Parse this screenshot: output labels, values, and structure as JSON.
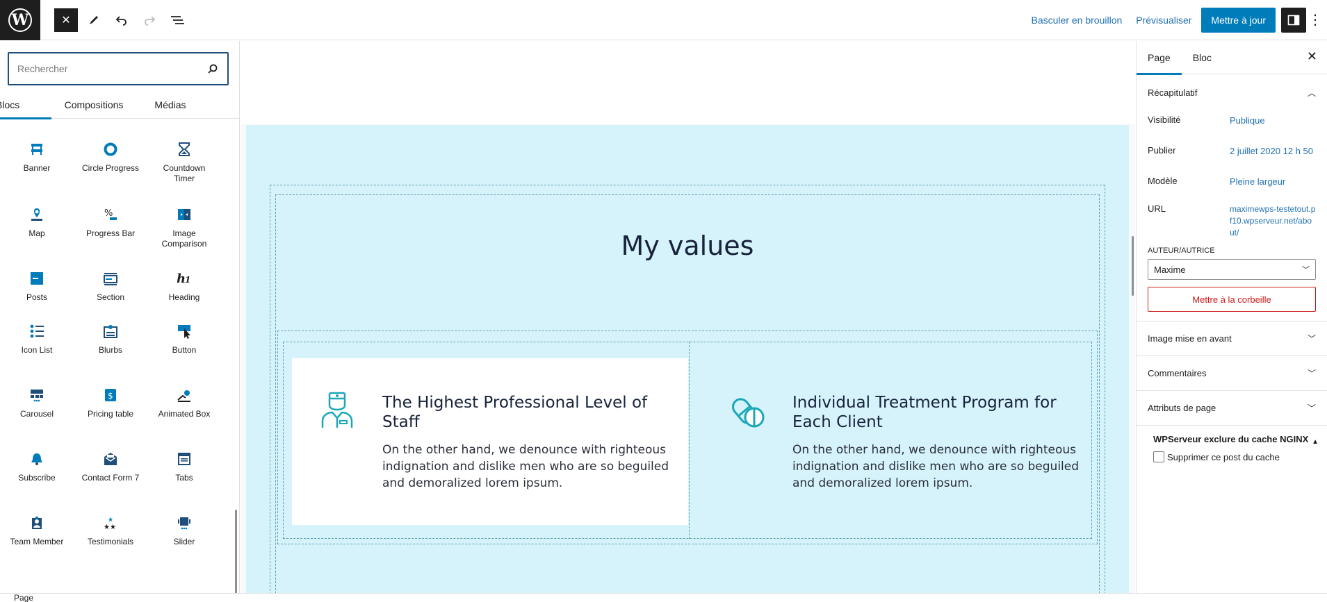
{
  "topbar": {
    "logo_letter": "W",
    "switch_to_draft": "Basculer en brouillon",
    "preview": "Prévisualiser",
    "update": "Mettre à jour"
  },
  "inserter": {
    "search_placeholder": "Rechercher",
    "tabs": [
      "Blocs",
      "Compositions",
      "Médias"
    ],
    "blocks": [
      {
        "label": "Banner",
        "icon": "banner-icon"
      },
      {
        "label": "Circle Progress",
        "icon": "circle-progress-icon"
      },
      {
        "label": "Countdown Timer",
        "icon": "hourglass-icon"
      },
      {
        "label": "Map",
        "icon": "map-pin-icon"
      },
      {
        "label": "Progress Bar",
        "icon": "percent-icon"
      },
      {
        "label": "Image Comparison",
        "icon": "image-comparison-icon"
      },
      {
        "label": "Posts",
        "icon": "posts-icon"
      },
      {
        "label": "Section",
        "icon": "section-icon"
      },
      {
        "label": "Heading",
        "icon": "heading-icon"
      },
      {
        "label": "Icon List",
        "icon": "list-icon"
      },
      {
        "label": "Blurbs",
        "icon": "blurbs-icon"
      },
      {
        "label": "Button",
        "icon": "cursor-icon"
      },
      {
        "label": "Carousel",
        "icon": "carousel-icon"
      },
      {
        "label": "Pricing table",
        "icon": "pricing-icon"
      },
      {
        "label": "Animated Box",
        "icon": "animated-box-icon"
      },
      {
        "label": "Subscribe",
        "icon": "bell-icon"
      },
      {
        "label": "Contact Form 7",
        "icon": "envelope-icon"
      },
      {
        "label": "Tabs",
        "icon": "tabs-icon"
      },
      {
        "label": "Team Member",
        "icon": "team-member-icon"
      },
      {
        "label": "Testimonials",
        "icon": "stars-icon"
      },
      {
        "label": "Slider",
        "icon": "slider-icon"
      }
    ]
  },
  "canvas": {
    "section_title": "My values",
    "cards": [
      {
        "title": "The Highest Professional  Level of Staff",
        "text": "On the other hand, we denounce with righteous indignation and dislike men who are so beguiled and demoralized lorem ipsum.",
        "icon": "doctor-icon"
      },
      {
        "title": "Individual Treatment Program  for Each Client",
        "text": "On the other hand, we denounce with righteous indignation and dislike men who are so beguiled and demoralized lorem ipsum.",
        "icon": "pills-icon"
      }
    ]
  },
  "status_bar": {
    "breadcrumb": "Page"
  },
  "sidebar": {
    "tabs": [
      "Page",
      "Bloc"
    ],
    "summary": {
      "title": "Récapitulatif",
      "visibility_label": "Visibilité",
      "visibility_value": "Publique",
      "publish_label": "Publier",
      "publish_value": "2 juillet 2020 12 h 50",
      "template_label": "Modèle",
      "template_value": "Pleine largeur",
      "url_label": "URL",
      "url_value": "maximewps-testetout.pf10.wpserveur.net/about/",
      "author_label": "AUTEUR/AUTRICE",
      "author_value": "Maxime",
      "trash": "Mettre à la corbeille"
    },
    "panels": [
      "Image mise en avant",
      "Commentaires",
      "Attributs de page"
    ],
    "nginx_title": "WPServeur exclure du cache NGINX",
    "nginx_checkbox": "Supprimer ce post du cache"
  },
  "colors": {
    "accent": "#007cba",
    "section_bg": "#d6f3fb",
    "icon_teal": "#1aa8b8",
    "danger": "#cc1818"
  }
}
